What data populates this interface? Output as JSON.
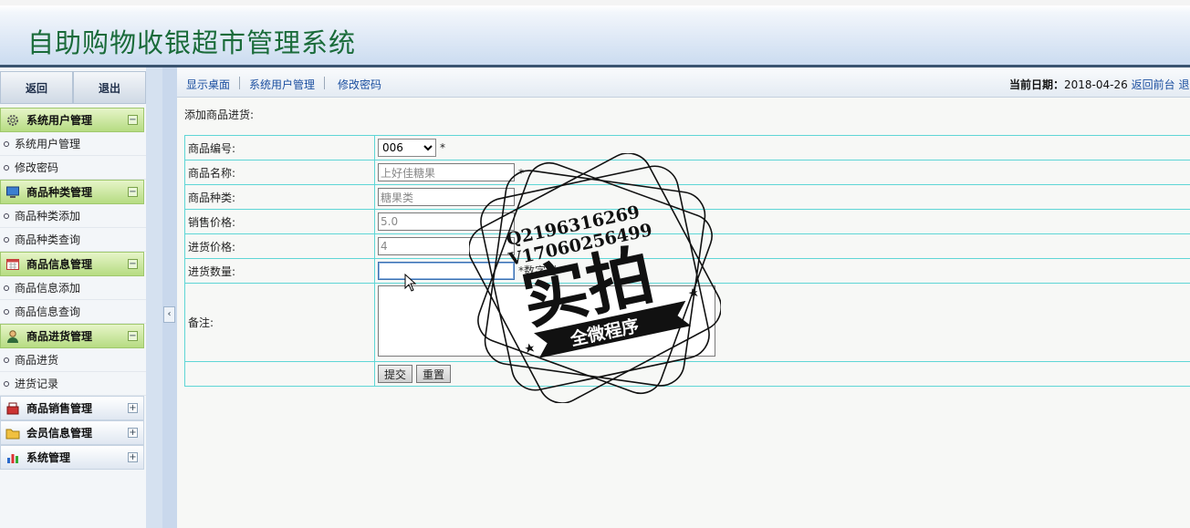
{
  "app_title": "自助购物收银超市管理系统",
  "sidebar": {
    "top_buttons": [
      {
        "label": "返回"
      },
      {
        "label": "退出"
      }
    ],
    "groups": [
      {
        "label": "系统用户管理",
        "icon": "gear-icon",
        "open": true,
        "toggle": "−",
        "items": [
          {
            "label": "系统用户管理"
          },
          {
            "label": "修改密码"
          }
        ]
      },
      {
        "label": "商品种类管理",
        "icon": "monitor-icon",
        "open": true,
        "toggle": "−",
        "items": [
          {
            "label": "商品种类添加"
          },
          {
            "label": "商品种类查询"
          }
        ]
      },
      {
        "label": "商品信息管理",
        "icon": "calendar-icon",
        "open": true,
        "toggle": "−",
        "items": [
          {
            "label": "商品信息添加"
          },
          {
            "label": "商品信息查询"
          }
        ]
      },
      {
        "label": "商品进货管理",
        "icon": "user-icon",
        "open": true,
        "toggle": "−",
        "items": [
          {
            "label": "商品进货"
          },
          {
            "label": "进货记录"
          }
        ]
      },
      {
        "label": "商品销售管理",
        "icon": "cash-register-icon",
        "open": false,
        "toggle": "+",
        "items": []
      },
      {
        "label": "会员信息管理",
        "icon": "folder-icon",
        "open": false,
        "toggle": "+",
        "items": []
      },
      {
        "label": "系统管理",
        "icon": "bar-chart-icon",
        "open": false,
        "toggle": "+",
        "items": []
      }
    ],
    "splitter_glyph": "‹"
  },
  "topnav": {
    "links": [
      {
        "label": "显示桌面"
      },
      {
        "label": "系统用户管理"
      },
      {
        "label": "修改密码"
      }
    ],
    "date_prefix": "当前日期：",
    "date_value": "2018-04-26",
    "back_link": "返回前台",
    "logout_link": "退出"
  },
  "page_title": "添加商品进货:",
  "form": {
    "product_id": {
      "label": "商品编号:",
      "value": "006",
      "required": "*"
    },
    "product_name": {
      "label": "商品名称:",
      "value": "上好佳糖果",
      "required": "*"
    },
    "product_category": {
      "label": "商品种类:",
      "value": "糖果类"
    },
    "sale_price": {
      "label": "销售价格:",
      "value": "5.0"
    },
    "purchase_price": {
      "label": "进货价格:",
      "value": "4"
    },
    "purchase_qty": {
      "label": "进货数量:",
      "value": "",
      "hint": "*数字型"
    },
    "remark": {
      "label": "备注:",
      "value": ""
    },
    "submit_label": "提交",
    "reset_label": "重置"
  },
  "watermark": {
    "qq": "Q2196316269",
    "wechat": "V17060256499",
    "main": "实拍",
    "ribbon": "全微程序"
  }
}
